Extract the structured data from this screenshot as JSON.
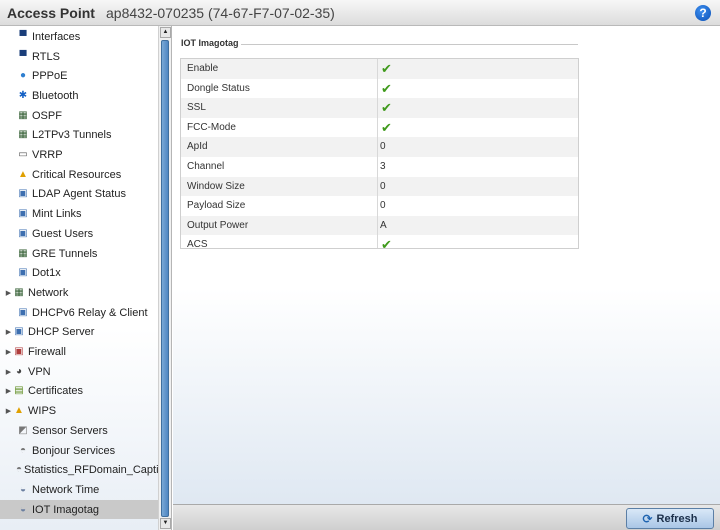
{
  "header": {
    "app_title": "Access Point",
    "device": "ap8432-070235 (74-67-F7-07-02-35)",
    "help_symbol": "?"
  },
  "sidebar": {
    "items": [
      {
        "label": "Interfaces",
        "icon": "interfaces-icon",
        "glyph": "▀",
        "color": "#1a3e7a",
        "arrow": false
      },
      {
        "label": "RTLS",
        "icon": "rtls-icon",
        "glyph": "▀",
        "color": "#1a3e7a",
        "arrow": false
      },
      {
        "label": "PPPoE",
        "icon": "pppoe-icon",
        "glyph": "●",
        "color": "#2f7fd0",
        "arrow": false
      },
      {
        "label": "Bluetooth",
        "icon": "bluetooth-icon",
        "glyph": "✱",
        "color": "#1460c4",
        "arrow": false
      },
      {
        "label": "OSPF",
        "icon": "ospf-icon",
        "glyph": "▦",
        "color": "#2d5a2d",
        "arrow": false
      },
      {
        "label": "L2TPv3 Tunnels",
        "icon": "l2tpv3-tunnels-icon",
        "glyph": "▦",
        "color": "#2d5a2d",
        "arrow": false
      },
      {
        "label": "VRRP",
        "icon": "vrrp-icon",
        "glyph": "▭",
        "color": "#555555",
        "arrow": false
      },
      {
        "label": "Critical Resources",
        "icon": "critical-resources-icon",
        "glyph": "▲",
        "color": "#e0a000",
        "arrow": false
      },
      {
        "label": "LDAP Agent Status",
        "icon": "ldap-agent-status-icon",
        "glyph": "▣",
        "color": "#3d6fb0",
        "arrow": false
      },
      {
        "label": "Mint Links",
        "icon": "mint-links-icon",
        "glyph": "▣",
        "color": "#3d6fb0",
        "arrow": false
      },
      {
        "label": "Guest Users",
        "icon": "guest-users-icon",
        "glyph": "▣",
        "color": "#3d6fb0",
        "arrow": false
      },
      {
        "label": "GRE Tunnels",
        "icon": "gre-tunnels-icon",
        "glyph": "▦",
        "color": "#2d5a2d",
        "arrow": false
      },
      {
        "label": "Dot1x",
        "icon": "dot1x-icon",
        "glyph": "▣",
        "color": "#3d6fb0",
        "arrow": false
      },
      {
        "label": "Network",
        "icon": "network-icon",
        "glyph": "▦",
        "color": "#2d5a2d",
        "arrow": true
      },
      {
        "label": "DHCPv6 Relay & Client",
        "icon": "dhcpv6-relay-icon",
        "glyph": "▣",
        "color": "#3d6fb0",
        "arrow": false
      },
      {
        "label": "DHCP Server",
        "icon": "dhcp-server-icon",
        "glyph": "▣",
        "color": "#3d6fb0",
        "arrow": true
      },
      {
        "label": "Firewall",
        "icon": "firewall-icon",
        "glyph": "▣",
        "color": "#b03d3d",
        "arrow": true
      },
      {
        "label": "VPN",
        "icon": "vpn-icon",
        "glyph": "◕",
        "color": "#444444",
        "arrow": true
      },
      {
        "label": "Certificates",
        "icon": "certificates-icon",
        "glyph": "▤",
        "color": "#5a8a1a",
        "arrow": true
      },
      {
        "label": "WIPS",
        "icon": "wips-icon",
        "glyph": "▲",
        "color": "#e0a000",
        "arrow": true
      },
      {
        "label": "Sensor Servers",
        "icon": "sensor-servers-icon",
        "glyph": "◩",
        "color": "#777777",
        "arrow": false
      },
      {
        "label": "Bonjour Services",
        "icon": "bonjour-services-icon",
        "glyph": "◓",
        "color": "#777777",
        "arrow": false
      },
      {
        "label": "Statistics_RFDomain_Capti",
        "icon": "statistics-rfdomain-icon",
        "glyph": "◓",
        "color": "#777777",
        "arrow": false
      },
      {
        "label": "Network Time",
        "icon": "network-time-icon",
        "glyph": "◒",
        "color": "#6b7fa0",
        "arrow": false
      },
      {
        "label": "IOT Imagotag",
        "icon": "iot-imagotag-icon",
        "glyph": "◒",
        "color": "#6b7fa0",
        "arrow": false,
        "selected": true
      }
    ]
  },
  "main": {
    "section_title": "IOT Imagotag",
    "rows": [
      {
        "key": "Enable",
        "value": "",
        "check": true
      },
      {
        "key": "Dongle Status",
        "value": "",
        "check": true
      },
      {
        "key": "SSL",
        "value": "",
        "check": true
      },
      {
        "key": "FCC-Mode",
        "value": "",
        "check": true
      },
      {
        "key": "ApId",
        "value": "0",
        "check": false
      },
      {
        "key": "Channel",
        "value": "3",
        "check": false
      },
      {
        "key": "Window Size",
        "value": "0",
        "check": false
      },
      {
        "key": "Payload Size",
        "value": "0",
        "check": false
      },
      {
        "key": "Output Power",
        "value": "A",
        "check": false
      },
      {
        "key": "ACS",
        "value": "",
        "check": true
      }
    ]
  },
  "footer": {
    "refresh_label": "Refresh"
  },
  "colors": {
    "check": "#3f9a1b",
    "selected_row": "#c9c9c9",
    "scroll_thumb": "#4f86c2"
  }
}
